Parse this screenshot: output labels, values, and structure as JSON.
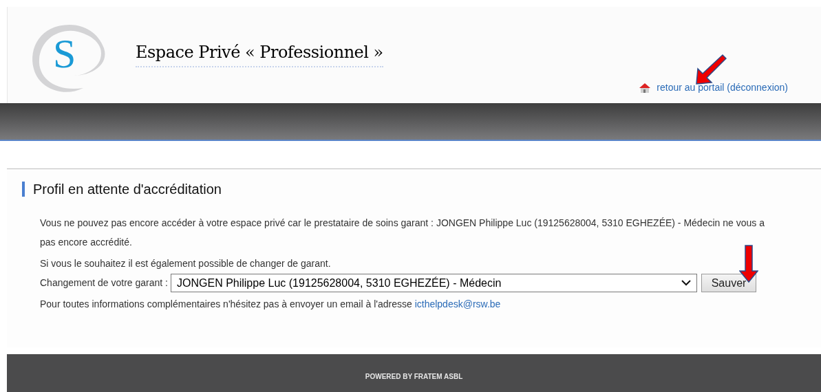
{
  "header": {
    "logo_letter": "S",
    "title": "Espace Privé « Professionnel »",
    "portal_link": "retour au portail (déconnexion)"
  },
  "section": {
    "heading": "Profil en attente d'accréditation",
    "message": "Vous ne pouvez pas encore accéder à votre espace privé car le prestataire de soins garant : JONGEN Philippe Luc (19125628004, 5310 EGHEZÉE) - Médecin ne vous a pas encore accrédité.",
    "hint": "Si vous le souhaitez il est également possible de changer de garant.",
    "guarantor_label": "Changement de votre garant :",
    "guarantor_value": "JONGEN Philippe Luc (19125628004, 5310 EGHEZÉE) - Médecin",
    "save_button": "Sauver",
    "contact_text": "Pour toutes informations complémentaires n'hésitez pas à envoyer un email à l'adresse",
    "contact_email": "icthelpdesk@rsw.be"
  },
  "footer": {
    "text": "POWERED BY FRATEM ASBL"
  }
}
